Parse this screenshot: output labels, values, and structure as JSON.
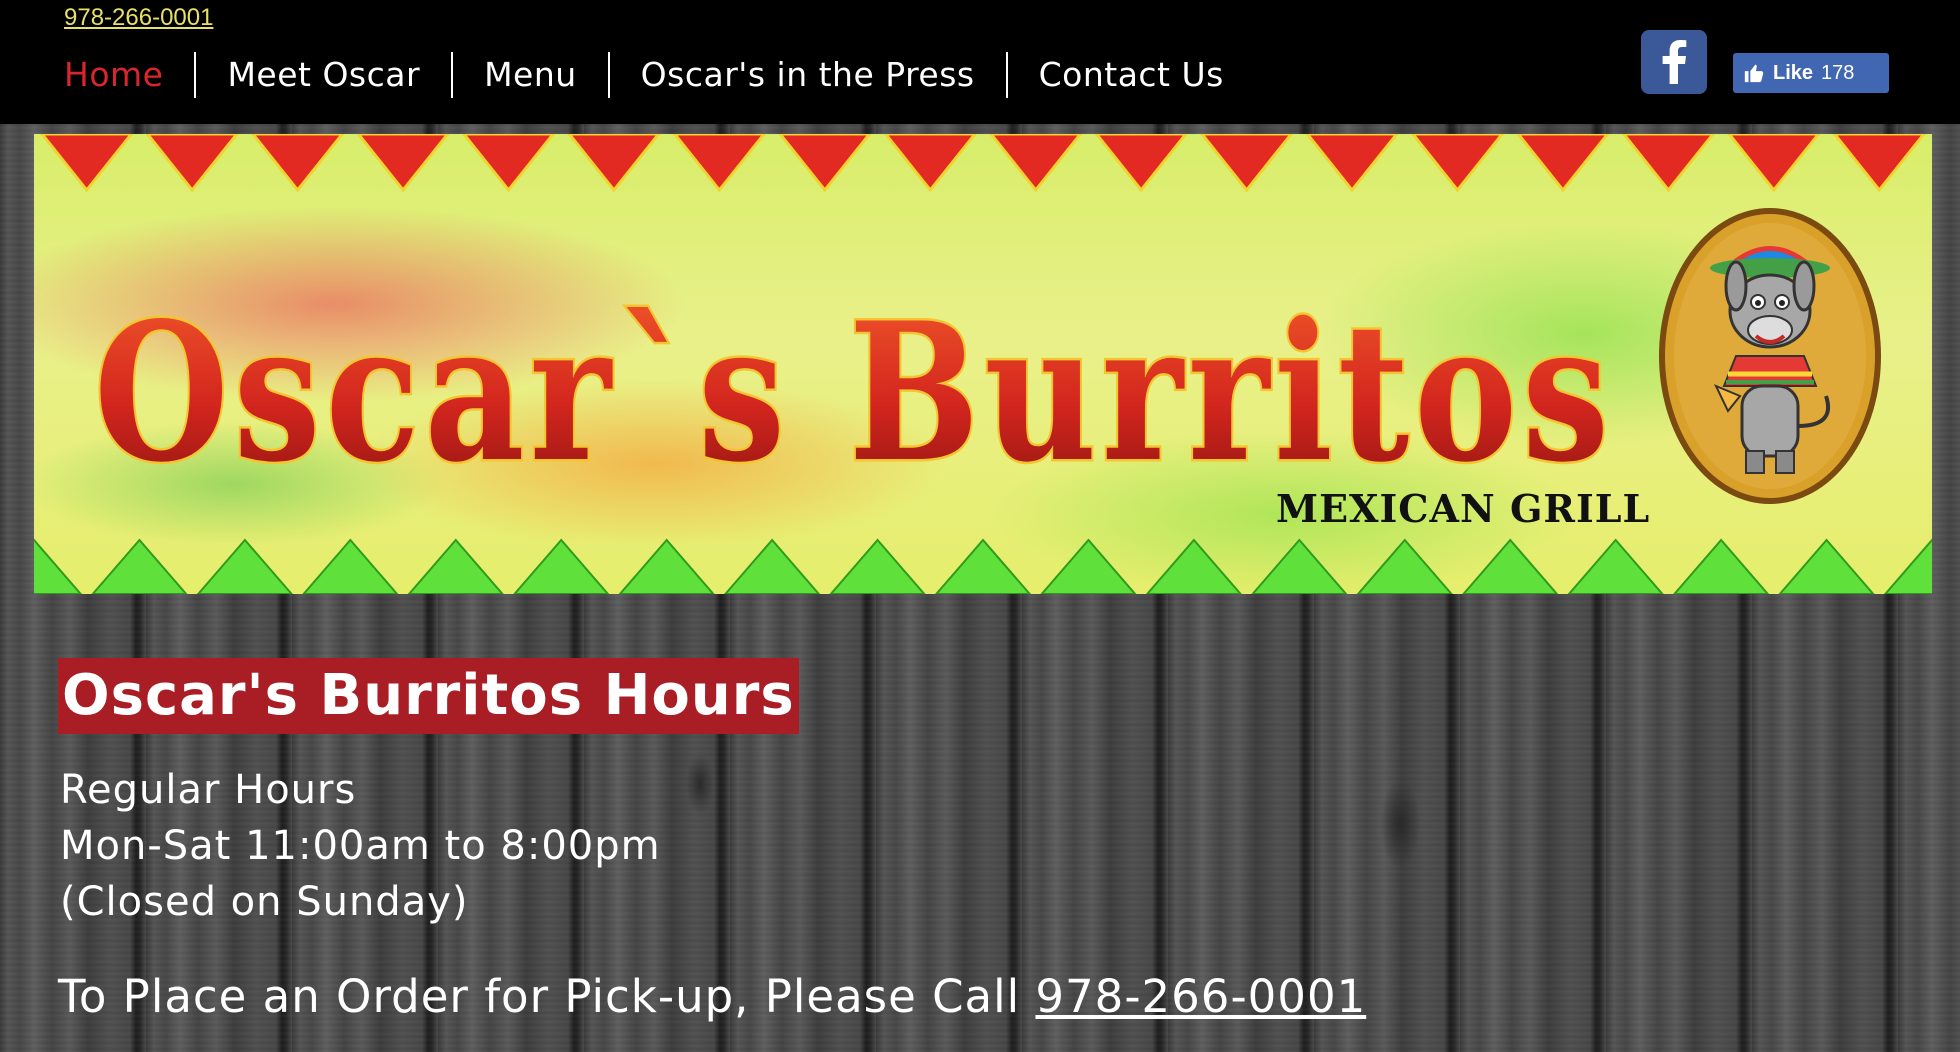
{
  "header": {
    "phone": "978-266-0001",
    "nav": [
      {
        "label": "Home",
        "active": true
      },
      {
        "label": "Meet Oscar",
        "active": false
      },
      {
        "label": "Menu",
        "active": false
      },
      {
        "label": "Oscar's in the Press",
        "active": false
      },
      {
        "label": "Contact Us",
        "active": false
      }
    ],
    "facebook_icon": "facebook-icon",
    "like_label": "Like",
    "like_count": "178"
  },
  "banner": {
    "title": "Oscar`s Burritos",
    "subtitle": "MEXICAN GRILL",
    "mascot": "donkey-with-sombrero-icon"
  },
  "main": {
    "heading": "Oscar's Burritos Hours",
    "hours_title": "Regular Hours",
    "hours_days": "Mon-Sat 11:00am to 8:00pm",
    "hours_note": "(Closed on Sunday)",
    "order_text": "To Place an Order for Pick-up, Please Call",
    "order_phone": "978-266-0001"
  },
  "colors": {
    "accent_red": "#a91d25",
    "nav_active": "#d8262a",
    "phone_link": "#e8e06a",
    "facebook_blue": "#3b5998"
  }
}
